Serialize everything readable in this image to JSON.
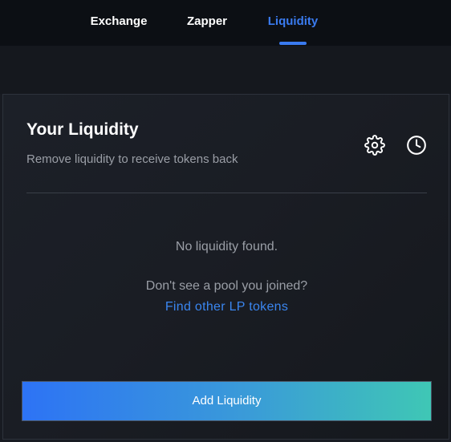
{
  "nav": {
    "tabs": [
      {
        "label": "Exchange",
        "active": false
      },
      {
        "label": "Zapper",
        "active": false
      },
      {
        "label": "Liquidity",
        "active": true
      }
    ]
  },
  "card": {
    "title": "Your Liquidity",
    "subtitle": "Remove liquidity to receive tokens back",
    "icons": {
      "settings": "gear-icon",
      "history": "clock-icon"
    },
    "empty_message": "No liquidity found.",
    "prompt": "Don't see a pool you joined?",
    "link_label": "Find other LP tokens",
    "add_button_label": "Add Liquidity"
  },
  "colors": {
    "accent": "#3a7bf0",
    "button_gradient_start": "#2d73f5",
    "button_gradient_end": "#3fc7b5",
    "background": "#181b22"
  }
}
